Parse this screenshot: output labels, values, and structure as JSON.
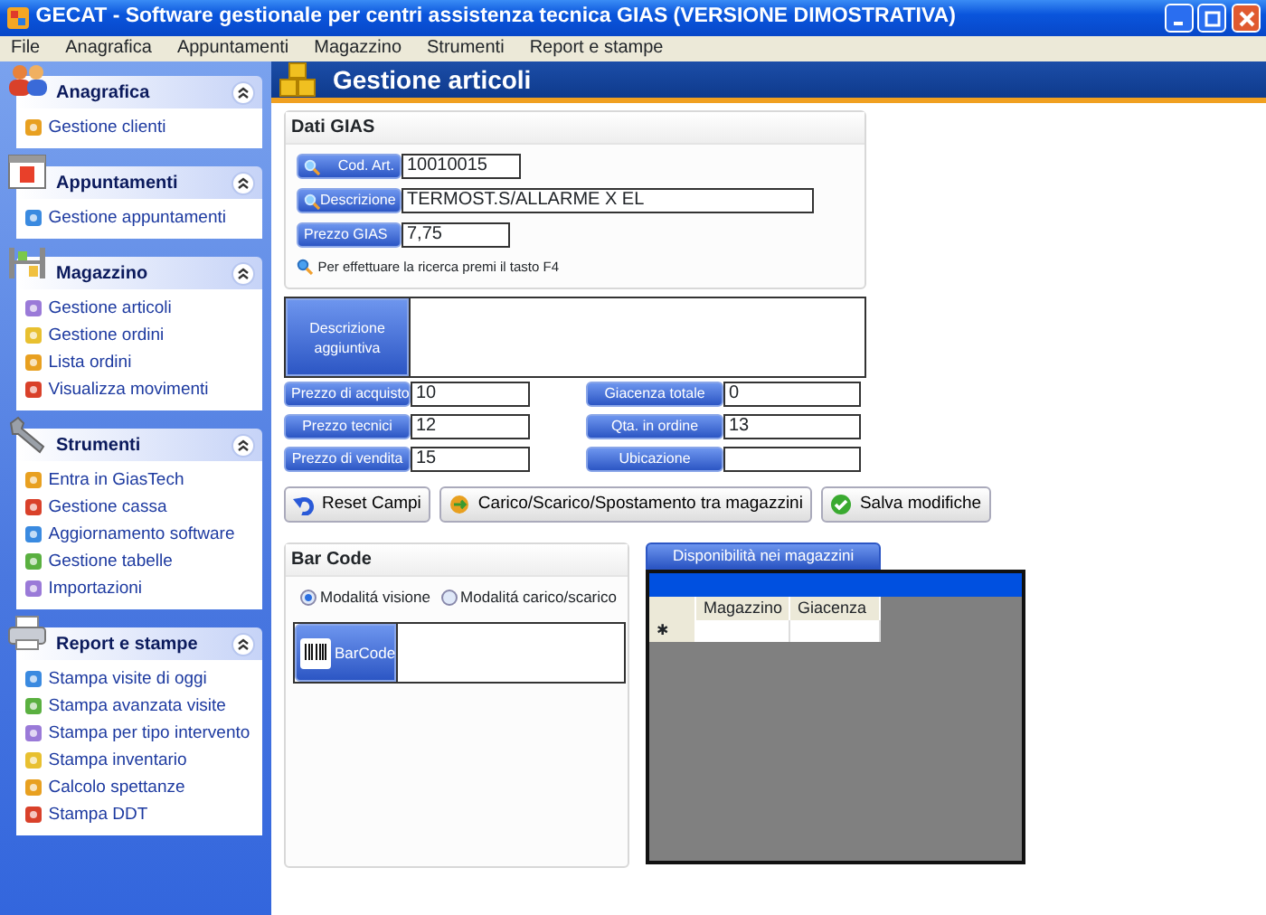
{
  "window": {
    "title": "GECAT - Software gestionale per centri assistenza tecnica GIAS (VERSIONE DIMOSTRATIVA)"
  },
  "menu": [
    "File",
    "Anagrafica",
    "Appuntamenti",
    "Magazzino",
    "Strumenti",
    "Report e stampe"
  ],
  "sidebar": {
    "groups": [
      {
        "title": "Anagrafica",
        "expanded": true,
        "items": [
          "Gestione clienti"
        ]
      },
      {
        "title": "Appuntamenti",
        "expanded": true,
        "items": [
          "Gestione appuntamenti"
        ]
      },
      {
        "title": "Magazzino",
        "expanded": true,
        "items": [
          "Gestione articoli",
          "Gestione ordini",
          "Lista ordini",
          "Visualizza movimenti"
        ]
      },
      {
        "title": "Strumenti",
        "expanded": true,
        "items": [
          "Entra in GiasTech",
          "Gestione cassa",
          "Aggiornamento software",
          "Gestione tabelle",
          "Importazioni"
        ]
      },
      {
        "title": "Report e stampe",
        "expanded": true,
        "items": [
          "Stampa visite di oggi",
          "Stampa avanzata visite",
          "Stampa per tipo intervento",
          "Stampa inventario",
          "Calcolo spettanze",
          "Stampa DDT"
        ]
      }
    ]
  },
  "header": {
    "title": "Gestione articoli"
  },
  "dati_gias": {
    "title": "Dati GIAS",
    "fields": [
      {
        "label": "Cod. Art.",
        "value": "10010015",
        "search": true,
        "kind": "short"
      },
      {
        "label": "Descrizione",
        "value": "TERMOST.S/ALLARME X EL",
        "search": true,
        "kind": "long"
      },
      {
        "label": "Prezzo GIAS",
        "value": "7,75",
        "search": false,
        "kind": "short"
      }
    ],
    "hint": "Per effettuare la ricerca premi il tasto F4"
  },
  "descrizione_aggiuntiva": {
    "label": "Descrizione aggiuntiva"
  },
  "prices": {
    "left": [
      {
        "label": "Prezzo di acquisto",
        "value": "10"
      },
      {
        "label": "Prezzo tecnici",
        "value": "12"
      },
      {
        "label": "Prezzo di vendita",
        "value": "15"
      }
    ],
    "right": [
      {
        "label": "Giacenza totale",
        "value": "0"
      },
      {
        "label": "Qta. in ordine",
        "value": "13"
      },
      {
        "label": "Ubicazione"
      }
    ]
  },
  "buttons": [
    {
      "label": "Reset Campi",
      "kind": "reset"
    },
    {
      "label": "Carico/Scarico/Spostamento tra magazzini",
      "kind": "transfer"
    },
    {
      "label": "Salva modifiche",
      "kind": "save"
    }
  ],
  "barcode": {
    "title": "Bar Code",
    "modes": [
      {
        "label": "Modalitá visione",
        "selected": true
      },
      {
        "label": "Modalitá carico/scarico",
        "selected": false
      }
    ],
    "button": "BarCode"
  },
  "availability": {
    "tab": "Disponibilità nei magazzini",
    "columns": [
      "Magazzino",
      "Giacenza"
    ],
    "new_row_marker": "✱"
  }
}
